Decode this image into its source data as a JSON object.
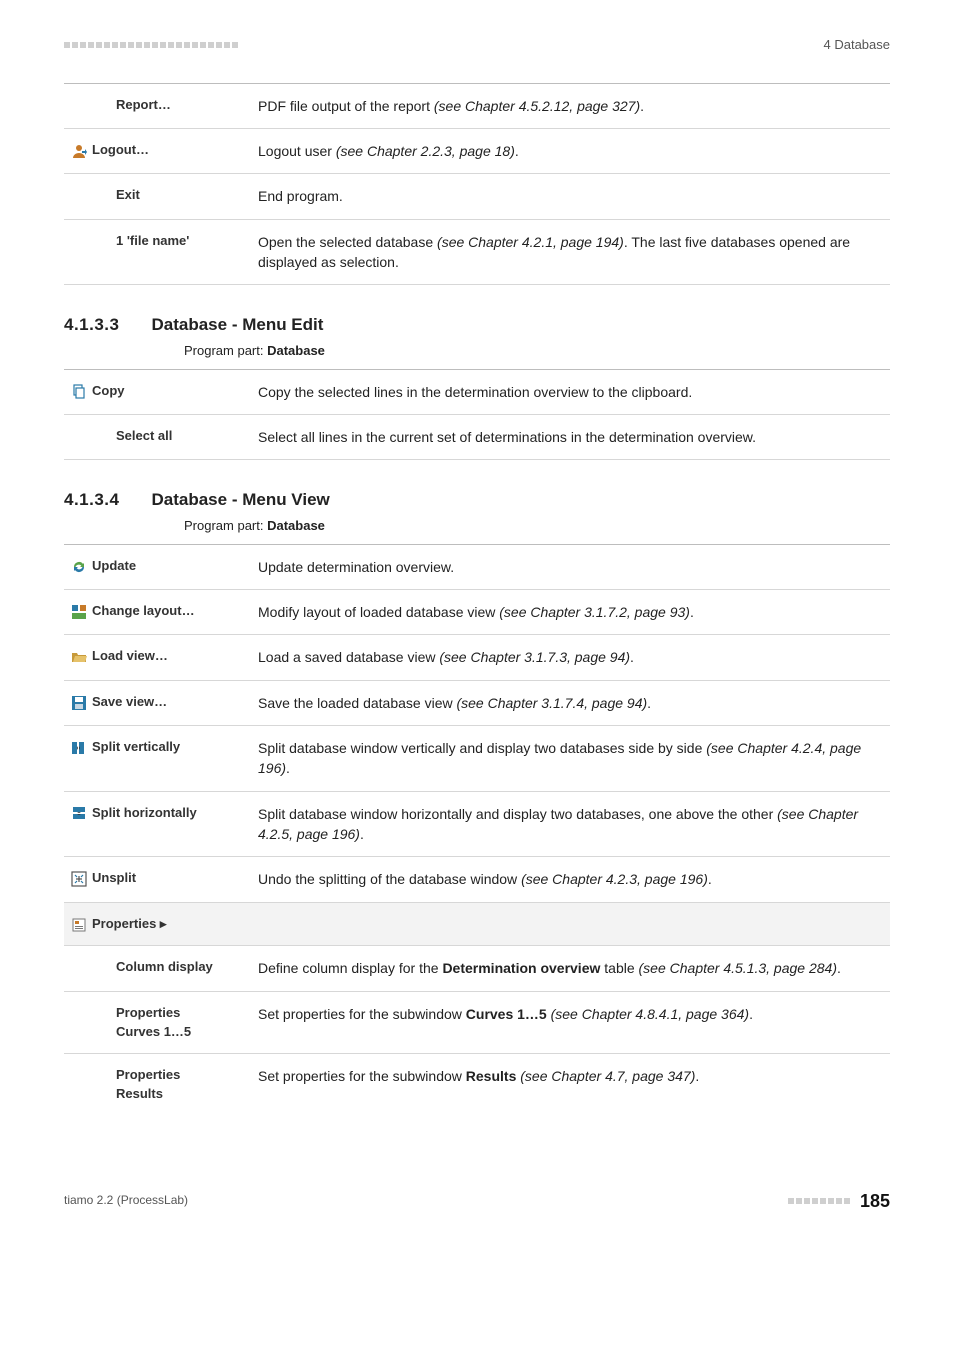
{
  "header": {
    "section_label": "4 Database"
  },
  "file_menu_tail": [
    {
      "key": "report",
      "label": "Report…",
      "indent": true,
      "icon": null,
      "desc": [
        {
          "t": "PDF file output of the report "
        },
        {
          "t": "(see Chapter 4.5.2.12, page 327)",
          "i": true
        },
        {
          "t": "."
        }
      ]
    },
    {
      "key": "logout",
      "label": "Logout…",
      "indent": false,
      "icon": "logout",
      "desc": [
        {
          "t": "Logout user "
        },
        {
          "t": "(see Chapter 2.2.3, page 18)",
          "i": true
        },
        {
          "t": "."
        }
      ]
    },
    {
      "key": "exit",
      "label": "Exit",
      "indent": true,
      "icon": null,
      "desc": [
        {
          "t": "End program."
        }
      ]
    },
    {
      "key": "filename",
      "label": "1 'file name'",
      "indent": true,
      "icon": null,
      "desc": [
        {
          "t": "Open the selected database "
        },
        {
          "t": "(see Chapter 4.2.1, page 194)",
          "i": true
        },
        {
          "t": ". The last five databases opened are displayed as selection."
        }
      ]
    }
  ],
  "section_edit": {
    "number": "4.1.3.3",
    "title": "Database - Menu Edit",
    "caption_label": "Program part: ",
    "caption_value": "Database"
  },
  "edit_menu": [
    {
      "key": "copy",
      "label": "Copy",
      "indent": false,
      "icon": "copy",
      "desc": [
        {
          "t": "Copy the selected lines in the determination overview to the clipboard."
        }
      ]
    },
    {
      "key": "selectall",
      "label": "Select all",
      "indent": true,
      "icon": null,
      "desc": [
        {
          "t": "Select all lines in the current set of determinations in the determination overview."
        }
      ]
    }
  ],
  "section_view": {
    "number": "4.1.3.4",
    "title": "Database - Menu View",
    "caption_label": "Program part: ",
    "caption_value": "Database"
  },
  "view_menu": [
    {
      "key": "update",
      "label": "Update",
      "icon": "refresh",
      "desc": [
        {
          "t": "Update determination overview."
        }
      ]
    },
    {
      "key": "change_layout",
      "label": "Change layout…",
      "icon": "layout",
      "desc": [
        {
          "t": "Modify layout of loaded database view "
        },
        {
          "t": "(see Chapter 3.1.7.2, page 93)",
          "i": true
        },
        {
          "t": "."
        }
      ]
    },
    {
      "key": "load_view",
      "label": "Load view…",
      "icon": "open",
      "desc": [
        {
          "t": "Load a saved database view "
        },
        {
          "t": "(see Chapter 3.1.7.3, page 94)",
          "i": true
        },
        {
          "t": "."
        }
      ]
    },
    {
      "key": "save_view",
      "label": "Save view…",
      "icon": "save",
      "desc": [
        {
          "t": "Save the loaded database view "
        },
        {
          "t": "(see Chapter 3.1.7.4, page 94)",
          "i": true
        },
        {
          "t": "."
        }
      ]
    },
    {
      "key": "split_v",
      "label": "Split vertically",
      "icon": "split-v",
      "desc": [
        {
          "t": "Split database window vertically and display two databases side by side "
        },
        {
          "t": "(see Chapter 4.2.4, page 196)",
          "i": true
        },
        {
          "t": "."
        }
      ]
    },
    {
      "key": "split_h",
      "label": "Split horizontally",
      "icon": "split-h",
      "desc": [
        {
          "t": "Split database window horizontally and display two databases, one above the other "
        },
        {
          "t": "(see Chapter 4.2.5, page 196)",
          "i": true
        },
        {
          "t": "."
        }
      ]
    },
    {
      "key": "unsplit",
      "label": "Unsplit",
      "icon": "unsplit",
      "desc": [
        {
          "t": "Undo the splitting of the database window "
        },
        {
          "t": "(see Chapter 4.2.3, page 196)",
          "i": true
        },
        {
          "t": "."
        }
      ]
    },
    {
      "key": "properties",
      "label": "Properties ▸",
      "icon": "properties",
      "shaded": true,
      "desc": []
    },
    {
      "key": "col_display",
      "label": "Column display",
      "indent": true,
      "desc": [
        {
          "t": "Define column display for the "
        },
        {
          "t": "Determination overview",
          "b": true
        },
        {
          "t": " table "
        },
        {
          "t": "(see Chapter 4.5.1.3, page 284)",
          "i": true
        },
        {
          "t": "."
        }
      ]
    },
    {
      "key": "prop_curves",
      "label": "Properties\nCurves 1…5",
      "indent": true,
      "desc": [
        {
          "t": "Set properties for the subwindow "
        },
        {
          "t": "Curves 1…5",
          "b": true
        },
        {
          "t": " "
        },
        {
          "t": "(see Chapter 4.8.4.1, page 364)",
          "i": true
        },
        {
          "t": "."
        }
      ]
    },
    {
      "key": "prop_results",
      "label": "Properties\nResults",
      "indent": true,
      "desc": [
        {
          "t": "Set properties for the subwindow "
        },
        {
          "t": "Results",
          "b": true
        },
        {
          "t": " "
        },
        {
          "t": "(see Chapter 4.7, page 347)",
          "i": true
        },
        {
          "t": "."
        }
      ]
    }
  ],
  "footer": {
    "product": "tiamo 2.2 (ProcessLab)",
    "page_number": "185"
  },
  "icons": {
    "logout": "logout-icon",
    "copy": "copy-icon",
    "refresh": "refresh-icon",
    "layout": "layout-icon",
    "open": "open-icon",
    "save": "save-icon",
    "split-v": "split-vertical-icon",
    "split-h": "split-horizontal-icon",
    "unsplit": "unsplit-icon",
    "properties": "properties-icon"
  }
}
